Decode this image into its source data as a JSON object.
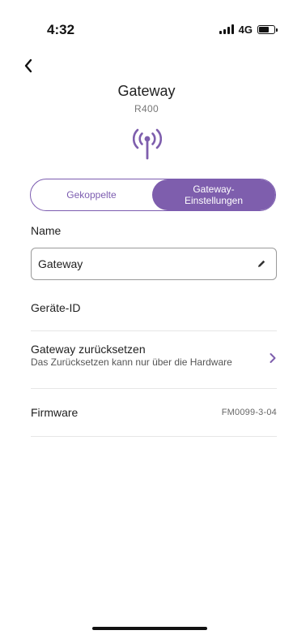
{
  "status_bar": {
    "time": "4:32",
    "network": "4G",
    "signal_bars": 4,
    "battery_level": 0.6
  },
  "header": {
    "title": "Gateway",
    "model": "R400"
  },
  "icons": {
    "back": "chevron-left-icon",
    "gateway": "antenna-broadcast-icon",
    "edit": "pencil-icon",
    "row_chevron": "chevron-right-icon"
  },
  "tabs": [
    {
      "label": "Gekoppelte",
      "selected": false
    },
    {
      "label": "Gateway-Einstellungen",
      "selected": true
    }
  ],
  "form": {
    "name_label": "Name",
    "name_value": "Gateway",
    "device_id_label": "Geräte-ID",
    "reset_title": "Gateway zurücksetzen",
    "reset_subtitle": "Das Zurücksetzen kann nur über die Hardware",
    "firmware_label": "Firmware",
    "firmware_value": "FM0099-3-04"
  },
  "colors": {
    "accent": "#7e5ead",
    "text": "#1f1f1f",
    "muted": "#777777",
    "divider": "#e6e6e6"
  }
}
